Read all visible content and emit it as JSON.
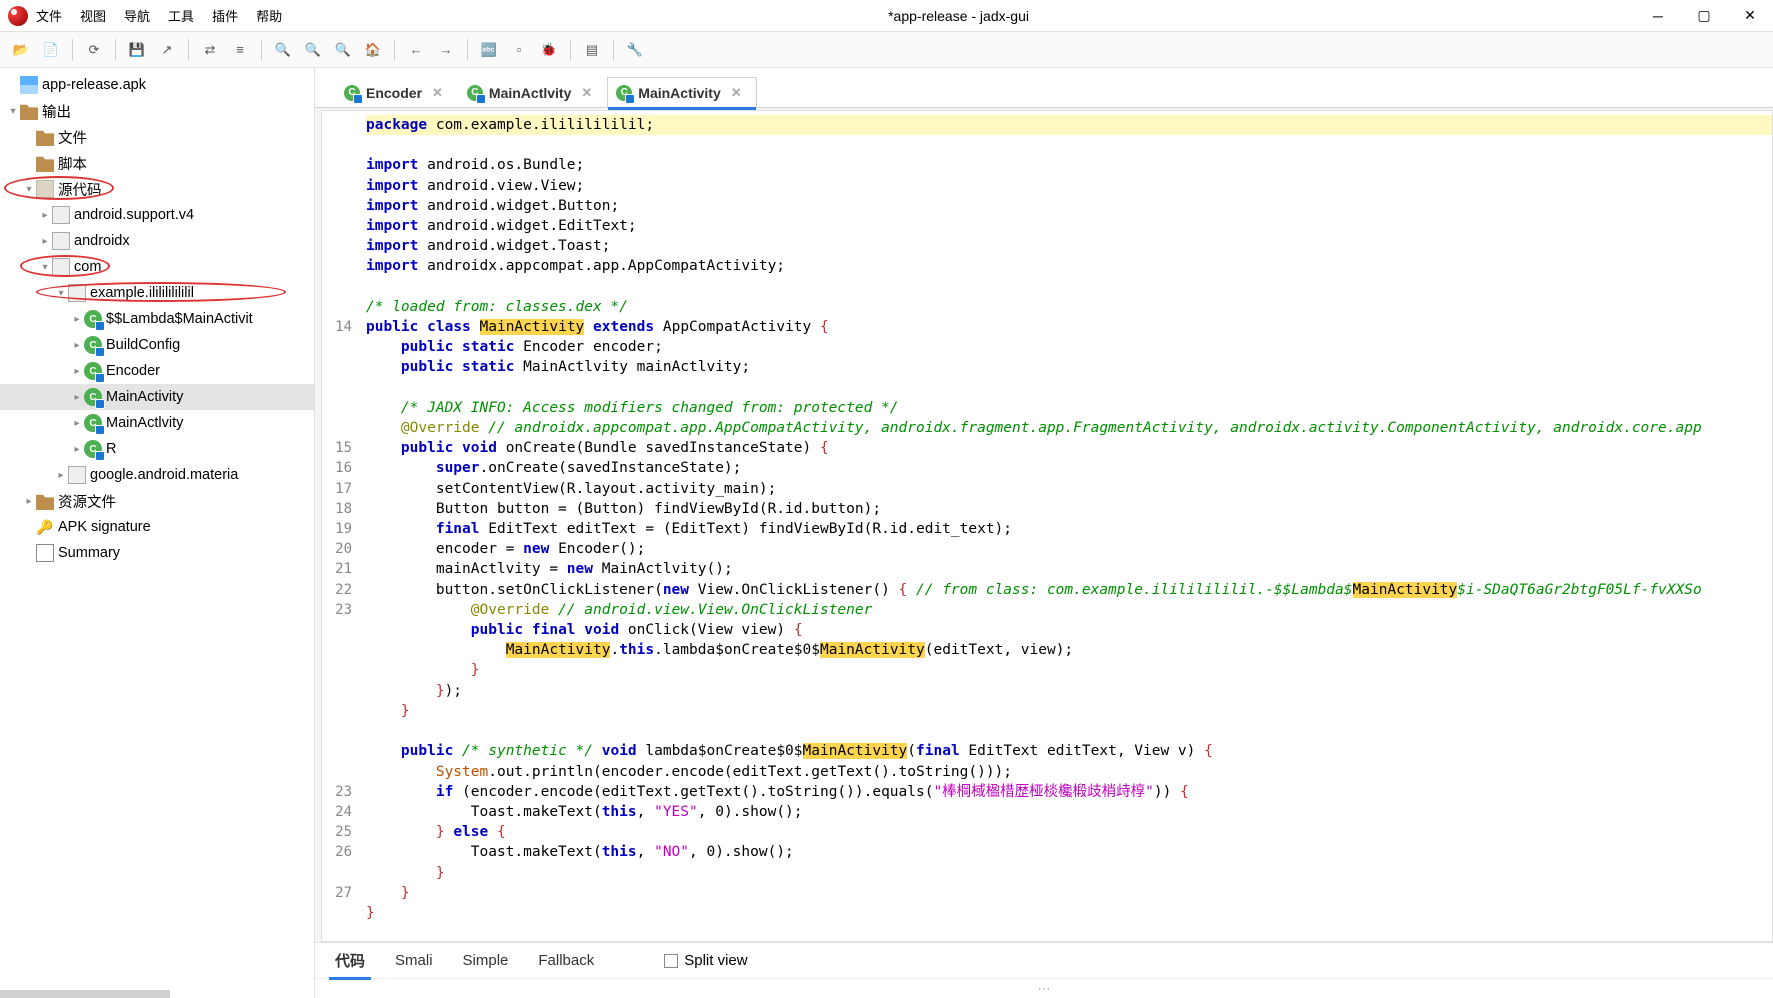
{
  "window": {
    "title": "*app-release - jadx-gui"
  },
  "menu": {
    "file": "文件",
    "view": "视图",
    "nav": "导航",
    "tools": "工具",
    "plugins": "插件",
    "help": "帮助"
  },
  "tree": {
    "root": "app-release.apk",
    "output": "输出",
    "file": "文件",
    "script": "脚本",
    "source": "源代码",
    "pkg1": "android.support.v4",
    "pkg2": "androidx",
    "pkg3": "com",
    "pkg4": "example.ililililililil",
    "cls1": "$$Lambda$MainActivit",
    "cls2": "BuildConfig",
    "cls3": "Encoder",
    "cls4": "MainActivity",
    "cls5": "MainActlvity",
    "cls6": "R",
    "pkg5": "google.android.materia",
    "resources": "资源文件",
    "apksig": "APK signature",
    "summary": "Summary"
  },
  "tabs": {
    "t1": "Encoder",
    "t2": "MainActlvity",
    "t3": "MainActivity"
  },
  "bottom": {
    "code": "代码",
    "smali": "Smali",
    "simple": "Simple",
    "fallback": "Fallback",
    "split": "Split view"
  },
  "gutter": [
    "",
    "",
    "",
    "",
    "",
    "",
    "",
    "",
    "",
    "",
    "14",
    "",
    "",
    "",
    "",
    "",
    "15",
    "16",
    "17",
    "18",
    "19",
    "20",
    "21",
    "22",
    "23",
    "",
    "",
    "",
    "",
    "",
    "",
    "",
    "",
    "23",
    "24",
    "25",
    "26",
    "",
    "27",
    "",
    "",
    "",
    ""
  ],
  "code": {
    "pkg_stmt": "com.example.ilililililil;",
    "imports": [
      "android.os.Bundle;",
      "android.view.View;",
      "android.widget.Button;",
      "android.widget.EditText;",
      "android.widget.Toast;",
      "androidx.appcompat.app.AppCompatActivity;"
    ],
    "cmt_loaded": "/* loaded from: classes.dex */",
    "extends_cls": "AppCompatActivity",
    "field1": "Encoder encoder;",
    "field2": "MainActlvity mainActlvity;",
    "jadx_info": "/* JADX INFO: Access modifiers changed from: protected */",
    "override_cmt": "// androidx.appcompat.app.AppCompatActivity, androidx.fragment.app.FragmentActivity, androidx.activity.ComponentActivity, androidx.core.app",
    "oncreate_sig": "onCreate(Bundle savedInstanceState)",
    "super_call": ".onCreate(savedInstanceState);",
    "line17": "setContentView(R.layout.activity_main);",
    "line18": "Button button = (Button) findViewById(R.id.button);",
    "line19_a": "EditText editText = (EditText) findViewById(R.id.edit_text);",
    "line20_a": "encoder = ",
    "line20_b": " Encoder();",
    "line21_a": "mainActlvity = ",
    "line21_b": " MainActlvity();",
    "line22_a": "button.setOnClickListener(",
    "line22_b": " View.OnClickListener()",
    "lambda_cmt_a": "// from class: com.example.ilililililil.-$$Lambda$",
    "lambda_cmt_b": "$i-SDaQT6aGr2btgF05Lf-fvXXSo",
    "inner_cmt": "// android.view.View.OnClickListener",
    "onclick_sig": "onClick(View view)",
    "lambda_call_a": ".lambda$onCreate$0$",
    "lambda_call_b": "(editText, view);",
    "synth_cmt": "/* synthetic */",
    "synth_sig_a": "lambda$onCreate$0$",
    "synth_sig_b": "EditText editText, View v)",
    "sys_line": ".out.println(encoder.encode(editText.getText().toString()));",
    "if_cond": "(encoder.encode(editText.getText().toString()).equals(",
    "chinese_str": "\"棒棡棫楹棤歴桠棪欃椴歧梢歭椁\"",
    "toast_yes_a": "Toast.makeText(",
    "toast_yes_b": ", 0).show();",
    "yes": "\"YES\"",
    "no": "\"NO\"",
    "this": "this",
    "super": "super",
    "final": "final",
    "new": "new",
    "void": "void",
    "public": "public",
    "static": "static",
    "class": "class",
    "package": "package",
    "import": "import",
    "if": "if",
    "else": "else",
    "extends": "extends",
    "override": "@Override",
    "system": "System",
    "mainact": "MainActivity"
  }
}
